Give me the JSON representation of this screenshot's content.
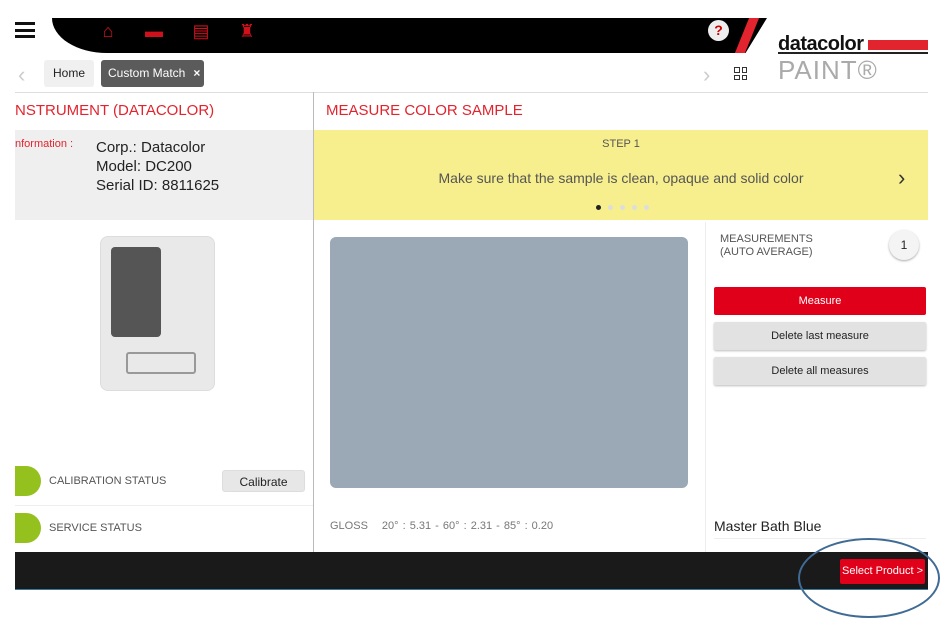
{
  "header": {
    "help": "?",
    "logo_top": "datacolor",
    "logo_bottom": "PAINT®",
    "icons": [
      "home-icon",
      "toolbox-icon",
      "printer-icon",
      "paint-can-icon"
    ]
  },
  "breadcrumb": {
    "home": "Home",
    "current": "Custom Match",
    "close": "×"
  },
  "left": {
    "title": "NSTRUMENT (DATACOLOR)",
    "info_label": "nformation :",
    "corp": "Corp.: Datacolor",
    "model": "Model: DC200",
    "serial": "Serial ID: 8811625",
    "calibration_status": "CALIBRATION STATUS",
    "calibrate_button": "Calibrate",
    "service_status": "SERVICE STATUS",
    "status_color": "#95c11f"
  },
  "main": {
    "title": "MEASURE COLOR SAMPLE",
    "step_label": "STEP 1",
    "step_text": "Make sure that the sample is clean, opaque and solid color",
    "step_total": 5,
    "step_current": 1,
    "sample_color": "#9aa9b5",
    "gloss_label": "GLOSS",
    "gloss_values": "20° : 5.31  -  60° : 2.31  -  85° : 0.20"
  },
  "right": {
    "measurements_label1": "MEASUREMENTS",
    "measurements_label2": "(AUTO AVERAGE)",
    "count": "1",
    "measure": "Measure",
    "delete_last": "Delete last measure",
    "delete_all": "Delete all measures",
    "color_name": "Master Bath Blue"
  },
  "footer": {
    "select_product": "Select Product >"
  }
}
